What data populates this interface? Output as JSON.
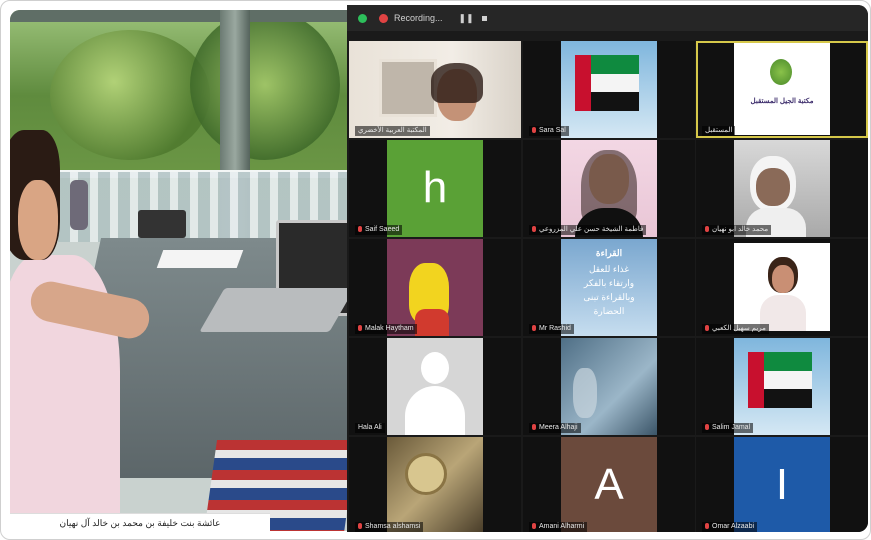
{
  "photo": {
    "caption": "عائشة بنت خليفة بن محمد بن خالد آل نهيان"
  },
  "zoom": {
    "recording_label": "Recording...",
    "tiles": [
      {
        "name": "المكتبة العربية الأخضري",
        "kind": "video"
      },
      {
        "name": "Sara Sal",
        "kind": "flag"
      },
      {
        "name": "المستقبل",
        "kind": "logo",
        "logo_text": "مكتبة الجيل المستقبل"
      },
      {
        "name": "Saif Saeed",
        "kind": "letter",
        "letter": "h",
        "color": "#5aa136"
      },
      {
        "name": "فاطمة الشيخة حسن علي المزروعي",
        "kind": "video"
      },
      {
        "name": "محمد خالد ابو نهيان",
        "kind": "video"
      },
      {
        "name": "Malak Haytham",
        "kind": "image"
      },
      {
        "name": "Mr Rashid",
        "kind": "poster",
        "poster_text": [
          "القراءة",
          "غذاء للعقل",
          "وارتقاء بالفكر",
          "وبالقراءة تبنى",
          "الحضارة"
        ]
      },
      {
        "name": "مريم سهيل الكعبي",
        "kind": "video"
      },
      {
        "name": "Hala Ali",
        "kind": "avatar"
      },
      {
        "name": "Meera Alhaji",
        "kind": "image"
      },
      {
        "name": "Salim Jamal",
        "kind": "flag"
      },
      {
        "name": "Shamsa alshamsi",
        "kind": "image"
      },
      {
        "name": "Amani Alharmi",
        "kind": "letter",
        "letter": "A",
        "color": "#6b4a3c"
      },
      {
        "name": "Omar Alzaabi",
        "kind": "letter",
        "letter": "I",
        "color": "#1e5aa8"
      }
    ]
  }
}
